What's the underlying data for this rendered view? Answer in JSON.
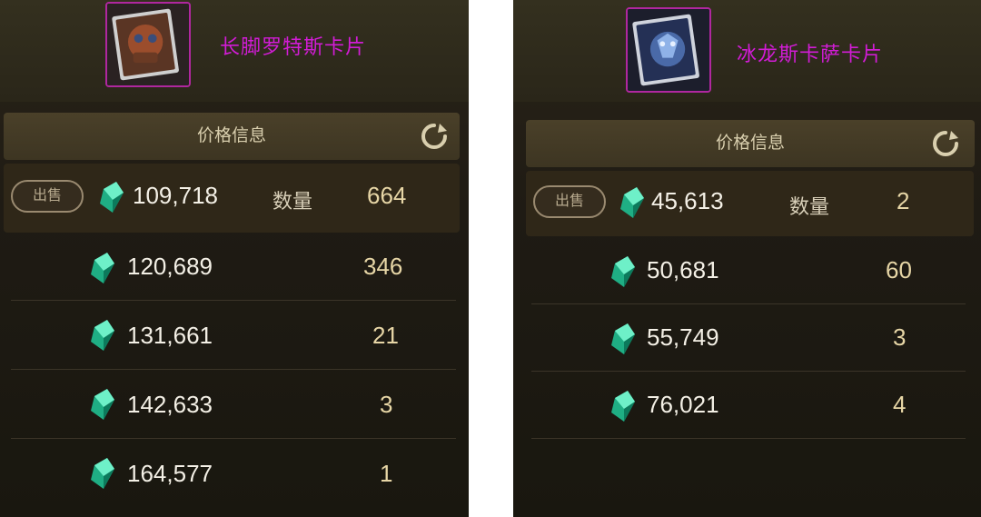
{
  "colors": {
    "card_name": "#d21cd6",
    "card_border": "#b0279f",
    "price_text": "#f4f0e6",
    "quantity_text": "#e7d6a6",
    "gem": "#3cd6a4"
  },
  "panels": [
    {
      "card": {
        "name": "长脚罗特斯卡片",
        "thumb_icon": "card-art-beast-icon"
      },
      "price_bar": {
        "title": "价格信息",
        "refresh_icon": "refresh-icon"
      },
      "listings": [
        {
          "sell_label": "出售",
          "currency_icon": "gem-icon",
          "price": "109,718",
          "qty_label": "数量",
          "qty": "664"
        },
        {
          "currency_icon": "gem-icon",
          "price": "120,689",
          "qty": "346"
        },
        {
          "currency_icon": "gem-icon",
          "price": "131,661",
          "qty": "21"
        },
        {
          "currency_icon": "gem-icon",
          "price": "142,633",
          "qty": "3"
        },
        {
          "currency_icon": "gem-icon",
          "price": "164,577",
          "qty": "1"
        }
      ]
    },
    {
      "card": {
        "name": "冰龙斯卡萨卡片",
        "thumb_icon": "card-art-ice-dragon-icon"
      },
      "price_bar": {
        "title": "价格信息",
        "refresh_icon": "refresh-icon"
      },
      "listings": [
        {
          "sell_label": "出售",
          "currency_icon": "gem-icon",
          "price": "45,613",
          "qty_label": "数量",
          "qty": "2"
        },
        {
          "currency_icon": "gem-icon",
          "price": "50,681",
          "qty": "60"
        },
        {
          "currency_icon": "gem-icon",
          "price": "55,749",
          "qty": "3"
        },
        {
          "currency_icon": "gem-icon",
          "price": "76,021",
          "qty": "4"
        }
      ]
    }
  ]
}
